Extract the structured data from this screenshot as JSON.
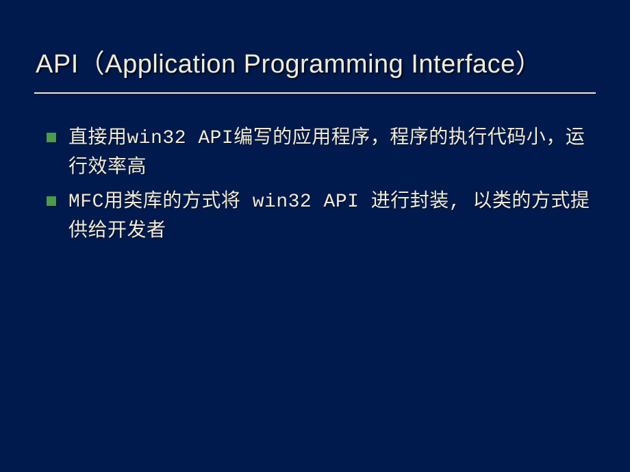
{
  "slide": {
    "title": "API（Application Programming Interface）",
    "bullets": [
      "直接用win32 API编写的应用程序，程序的执行代码小，运行效率高",
      "MFC用类库的方式将 win32 API 进行封装, 以类的方式提供给开发者"
    ]
  },
  "colors": {
    "background": "#001a4d",
    "text": "#f0ecd8",
    "bullet": "#4a9b4a"
  }
}
